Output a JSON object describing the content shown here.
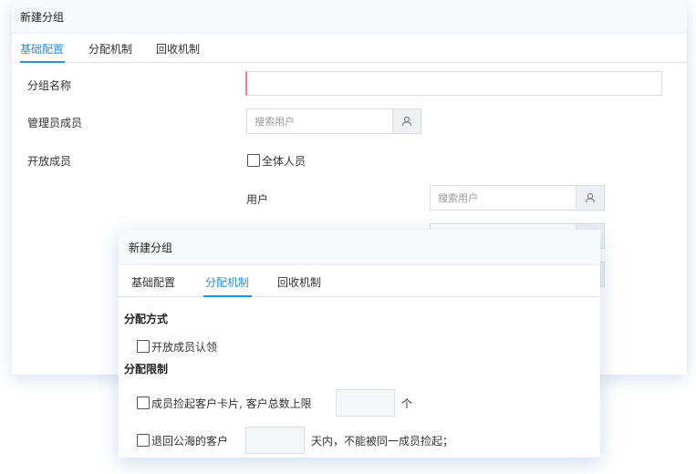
{
  "back_dialog": {
    "title": "新建分组",
    "tabs": [
      {
        "label": "基础配置",
        "active": true
      },
      {
        "label": "分配机制",
        "active": false
      },
      {
        "label": "回收机制",
        "active": false
      }
    ],
    "group_name_label": "分组名称",
    "group_name_value": "",
    "admin_label": "管理员成员",
    "admin_search_placeholder": "搜索用户",
    "open_members_label": "开放成员",
    "all_members_checkbox_label": "全体人员",
    "all_members_checked": false,
    "user_label": "用户",
    "user_search_placeholder": "搜索用户"
  },
  "front_dialog": {
    "title": "新建分组",
    "tabs": [
      {
        "label": "基础配置",
        "active": false
      },
      {
        "label": "分配机制",
        "active": true
      },
      {
        "label": "回收机制",
        "active": false
      }
    ],
    "allocation_method_heading": "分配方式",
    "open_member_claim_label": "开放成员认领",
    "open_member_claim_checked": false,
    "allocation_limit_heading": "分配限制",
    "limit_rule_label": "成员捡起客户卡片, 客户总数上限",
    "limit_rule_checked": false,
    "limit_rule_value": "",
    "limit_rule_unit": "个",
    "return_rule_label": "退回公海的客户",
    "return_rule_checked": false,
    "return_rule_value": "",
    "return_rule_suffix": "天内，不能被同一成员捡起；"
  },
  "colors": {
    "accent": "#2a8fe0",
    "required_marker": "#f08080",
    "title_bar_bg": "#f6f8fb"
  },
  "icons": {
    "search_user": "user-icon"
  }
}
